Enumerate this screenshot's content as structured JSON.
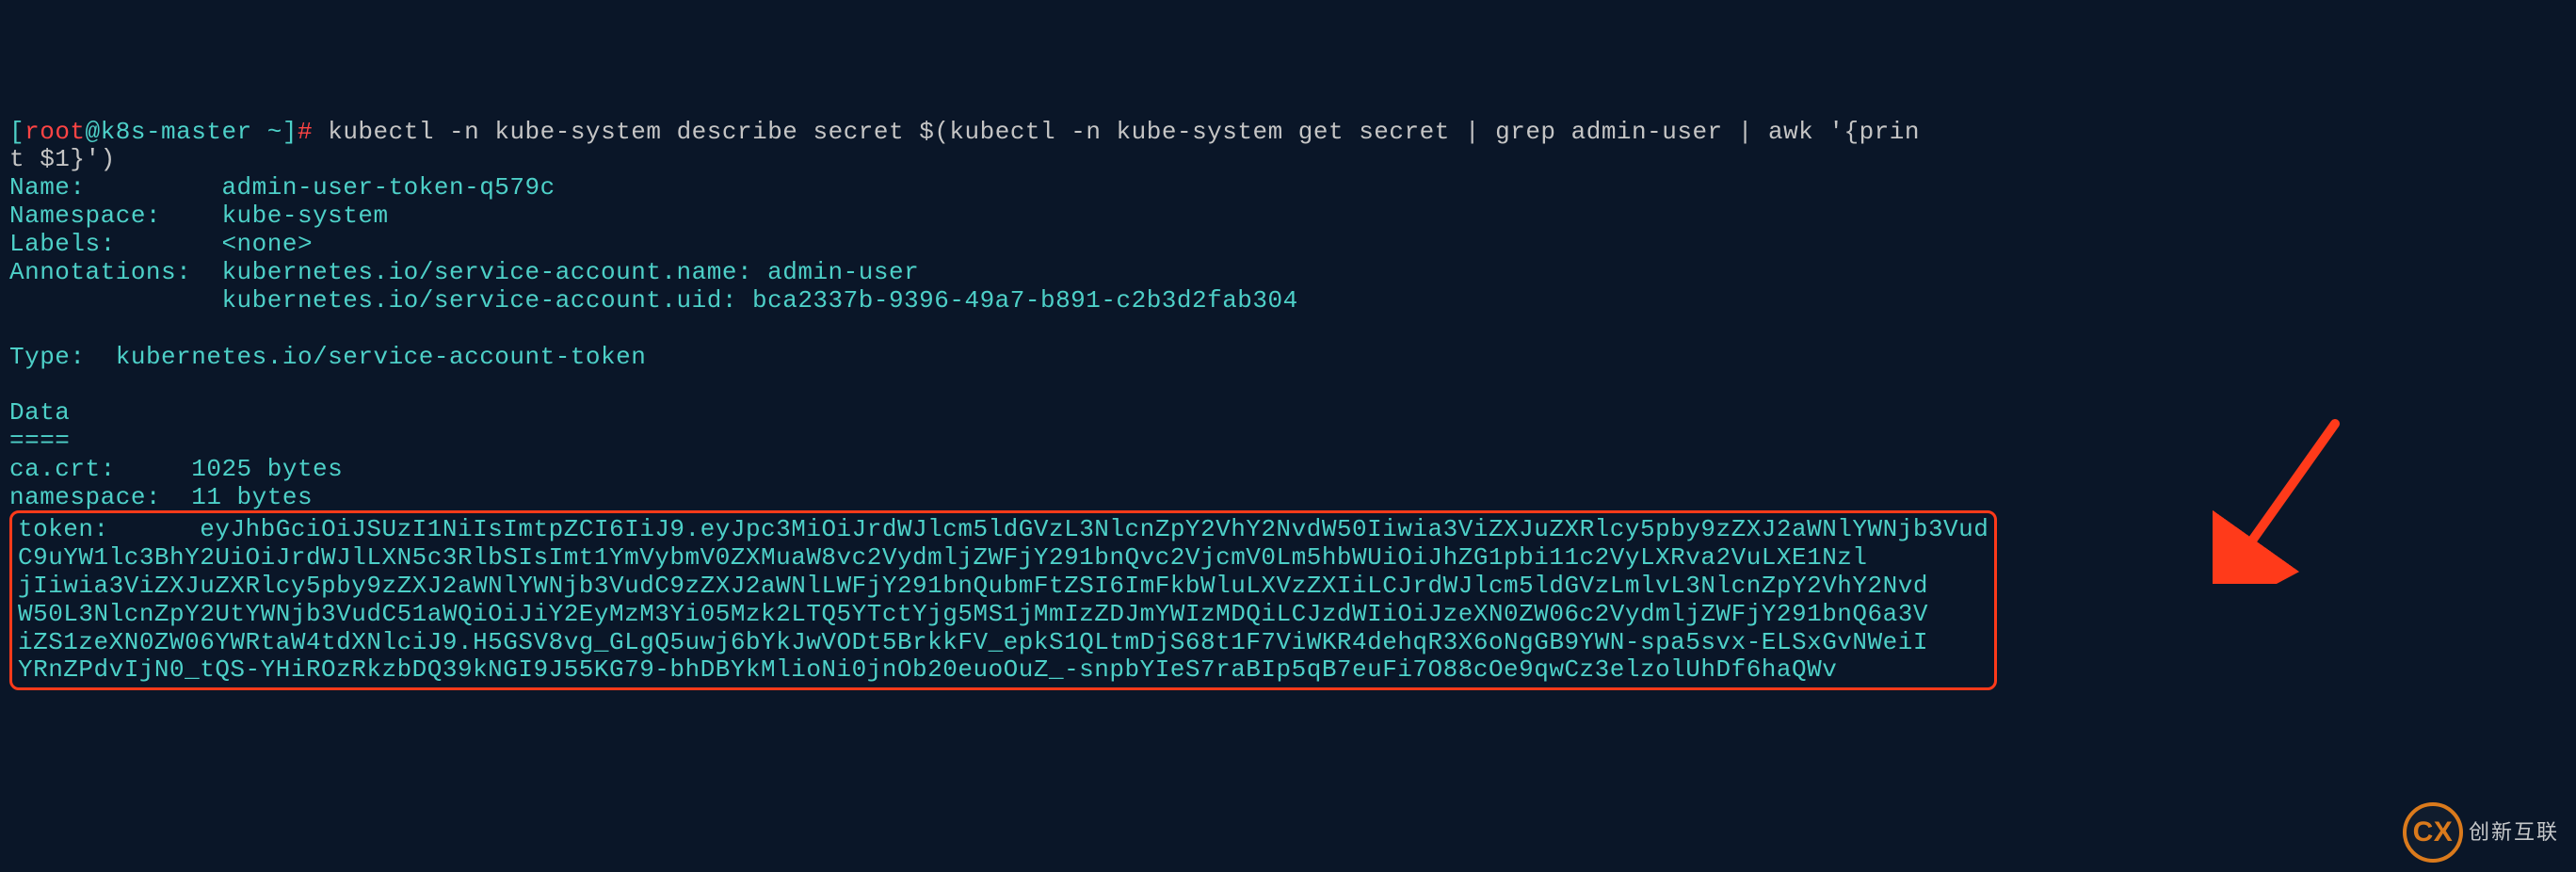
{
  "prompt": {
    "user": "root",
    "host": "k8s-master",
    "cwd": "~",
    "symbol": "#"
  },
  "command": {
    "line1": "kubectl -n kube-system describe secret $(kubectl -n kube-system get secret | grep admin-user | awk '{prin",
    "line2": "t $1}')"
  },
  "output": {
    "name_label": "Name:",
    "name_value": "admin-user-token-q579c",
    "namespace_label": "Namespace:",
    "namespace_value": "kube-system",
    "labels_label": "Labels:",
    "labels_value": "<none>",
    "annotations_label": "Annotations:",
    "annotations_value1": "kubernetes.io/service-account.name: admin-user",
    "annotations_value2": "kubernetes.io/service-account.uid: bca2337b-9396-49a7-b891-c2b3d2fab304",
    "type_label": "Type:",
    "type_value": "kubernetes.io/service-account-token",
    "data_label": "Data",
    "data_sep": "====",
    "cacrt_label": "ca.crt:",
    "cacrt_value": "1025 bytes",
    "ns_label": "namespace:",
    "ns_value": "11 bytes",
    "token_label": "token:",
    "token_l1": "eyJhbGciOiJSUzI1NiIsImtpZCI6IiJ9.eyJpc3MiOiJrdWJlcm5ldGVzL3NlcnZpY2VhY2NvdW50Iiwia3ViZXJuZXRlcy5pby9zZXJ2aWNlYWNjb3Vud",
    "token_l2": "C9uYW1lc3BhY2UiOiJrdWJlLXN5c3RlbSIsImt1YmVybmV0ZXMuaW8vc2VydmljZWFjY291bnQvc2VjcmV0Lm5hbWUiOiJhZG1pbi11c2VyLXRva2VuLXE1Nzl",
    "token_l3": "jIiwia3ViZXJuZXRlcy5pby9zZXJ2aWNlYWNjb3VudC9zZXJ2aWNlLWFjY291bnQubmFtZSI6ImFkbWluLXVzZXIiLCJrdWJlcm5ldGVzLmlvL3NlcnZpY2VhY2Nvd",
    "token_l4": "W50L3NlcnZpY2UtYWNjb3VudC51aWQiOiJiY2EyMzM3Yi05Mzk2LTQ5YTctYjg5MS1jMmIzZDJmYWIzMDQiLCJzdWIiOiJzeXN0ZW06c2VydmljZWFjY291bnQ6a3V",
    "token_l5": "iZS1zeXN0ZW06YWRtaW4tdXNlciJ9.H5GSV8vg_GLgQ5uwj6bYkJwVODt5BrkkFV_epkS1QLtmDjS68t1F7ViWKR4dehqR3X6oNgGB9YWN-spa5svx-ELSxGvNWeiI",
    "token_l6": "YRnZPdvIjN0_tQS-YHiROzRkzbDQ39kNGI9J55KG79-bhDBYkMlioNi0jnOb20euoOuZ_-snpbYIeS7raBIp5qB7euFi7O88cOe9qwCz3elzolUhDf6haQWv"
  },
  "watermark": {
    "badge": "CX",
    "text": "创新互联"
  }
}
